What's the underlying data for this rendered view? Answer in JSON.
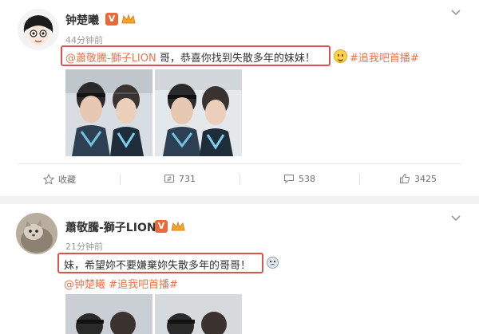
{
  "post1": {
    "author": "钟楚曦",
    "time": "44分钟前",
    "mention": "@蕭敬騰-獅子LION",
    "text": " 哥，恭喜你找到失散多年的妹妹！",
    "hashtag": "#追我吧首播#",
    "actions": {
      "favorite_label": "收藏",
      "repost_count": "731",
      "comment_count": "538",
      "like_count": "3425"
    }
  },
  "post2": {
    "author": "蕭敬騰-獅子LION",
    "time": "21分钟前",
    "text": "妹，希望妳不要嫌棄妳失散多年的哥哥！",
    "mention": "@钟楚曦",
    "hashtag": "#追我吧首播#"
  },
  "badges": {
    "verified": "V"
  }
}
